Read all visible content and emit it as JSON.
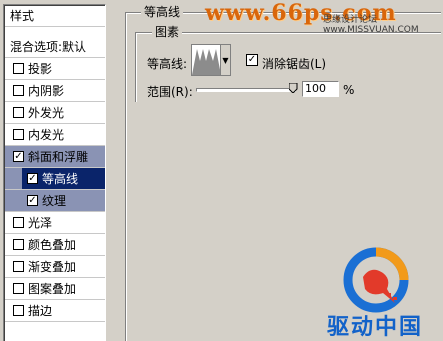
{
  "style_panel": {
    "header": "样式",
    "blend_options": "混合选项:默认",
    "items": [
      {
        "label": "投影",
        "checked": false
      },
      {
        "label": "内阴影",
        "checked": false
      },
      {
        "label": "外发光",
        "checked": false
      },
      {
        "label": "内发光",
        "checked": false
      },
      {
        "label": "斜面和浮雕",
        "checked": true
      },
      {
        "label": "等高线",
        "checked": true
      },
      {
        "label": "纹理",
        "checked": true
      },
      {
        "label": "光泽",
        "checked": false
      },
      {
        "label": "颜色叠加",
        "checked": false
      },
      {
        "label": "渐变叠加",
        "checked": false
      },
      {
        "label": "图案叠加",
        "checked": false
      },
      {
        "label": "描边",
        "checked": false
      }
    ]
  },
  "contour_panel": {
    "title": "等高线",
    "group_title": "图素",
    "contour_label": "等高线:",
    "anti_alias_label": "消除锯齿(L)",
    "anti_alias_checked": true,
    "range_label": "范围(R):",
    "range_value": "100",
    "range_unit": "%"
  },
  "watermark": {
    "site": "www.66ps.com",
    "site_secondary": "思缘设计论坛 www.MISSVUAN.COM",
    "brand": "驱动中国"
  },
  "colors": {
    "window_bg": "#d4d0c8",
    "selected_dark": "#0a246a",
    "selected_light": "#8a93b4"
  }
}
